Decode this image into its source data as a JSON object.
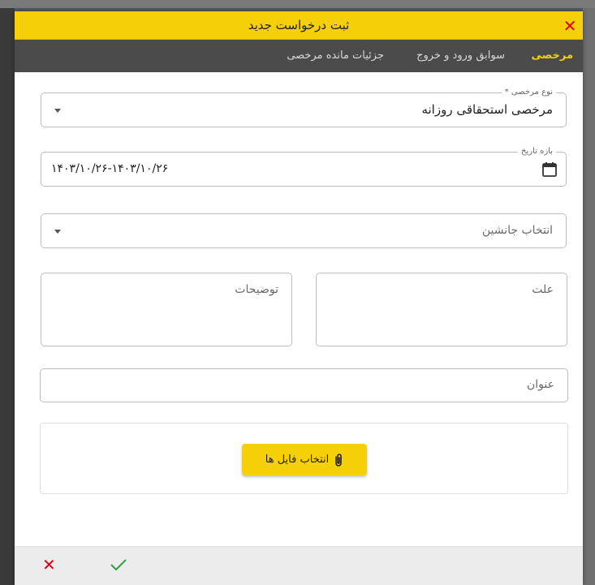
{
  "dialog": {
    "title": "ثبت درخواست جدید",
    "close_icon": "close-icon"
  },
  "tabs": [
    {
      "label": "مرخصی",
      "active": true
    },
    {
      "label": "سوابق ورود و خروج",
      "active": false
    },
    {
      "label": "جزئیات مانده مرخصی",
      "active": false
    }
  ],
  "form": {
    "leave_type": {
      "label": "نوع مرخصی *",
      "value": "مرخصی استحقاقی روزانه"
    },
    "date_range": {
      "label": "بازه تاریخ",
      "value": "۱۴۰۳/۱۰/۲۶-۱۴۰۳/۱۰/۲۶",
      "icon": "calendar-icon"
    },
    "substitute": {
      "placeholder": "انتخاب جانشین"
    },
    "reason": {
      "placeholder": "علت"
    },
    "description": {
      "placeholder": "توضیحات"
    },
    "subject": {
      "placeholder": "عنوان"
    },
    "upload": {
      "button_label": "انتخاب فایل ها",
      "icon": "paperclip-icon"
    }
  },
  "footer": {
    "cancel_icon": "close-icon",
    "confirm_icon": "check-icon"
  },
  "colors": {
    "accent": "#f5cf08",
    "tabs_bg": "#4b4b4b",
    "danger": "#e3001b",
    "success": "#2e9e44"
  }
}
